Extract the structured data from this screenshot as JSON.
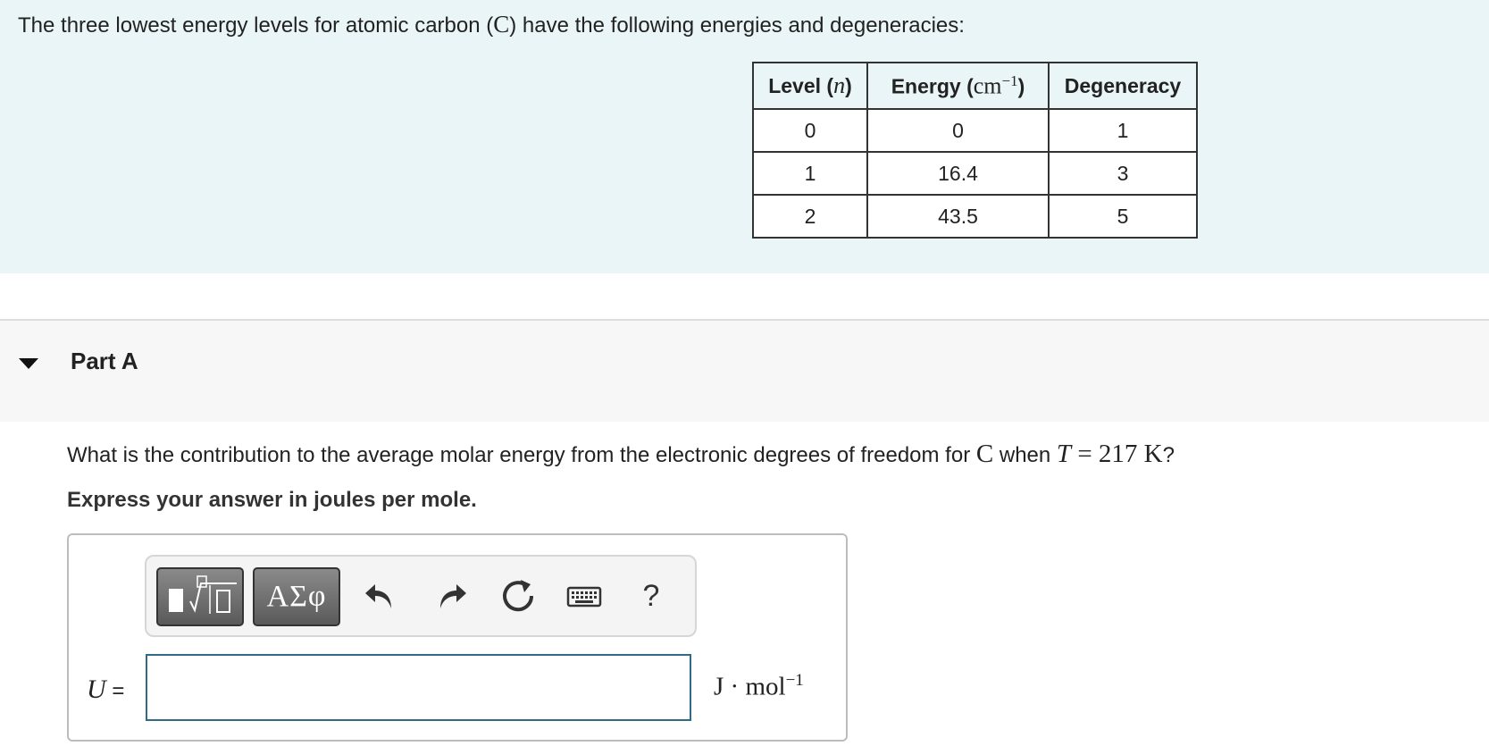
{
  "intro": {
    "text_before": "The three lowest energy levels for atomic carbon (",
    "symbol": "C",
    "text_after": ") have the following energies and degeneracies:"
  },
  "table": {
    "headers": {
      "level_label": "Level (",
      "level_var": "n",
      "level_close": ")",
      "energy_label": "Energy (",
      "energy_unit": "cm",
      "energy_exp": "−1",
      "energy_close": ")",
      "degeneracy": "Degeneracy"
    },
    "rows": [
      [
        "0",
        "0",
        "1"
      ],
      [
        "1",
        "16.4",
        "3"
      ],
      [
        "2",
        "43.5",
        "5"
      ]
    ]
  },
  "part": {
    "title": "Part A"
  },
  "question": {
    "text_1": "What is the contribution to the average molar energy from the electronic degrees of freedom for ",
    "symbol": "C",
    "text_2": " when ",
    "var": "T",
    "equation": " = 217 K",
    "text_3": "?",
    "instruction": "Express your answer in joules per mole."
  },
  "toolbar": {
    "templates_icon": "templates-icon",
    "symbols_label": "ΑΣφ",
    "undo_icon": "undo-icon",
    "redo_icon": "redo-icon",
    "reset_icon": "reset-icon",
    "keyboard_icon": "keyboard-icon",
    "help_label": "?"
  },
  "answer": {
    "variable": "U",
    "equals": " =",
    "value": "",
    "unit_base": "J · mol",
    "unit_exp": "−1"
  }
}
